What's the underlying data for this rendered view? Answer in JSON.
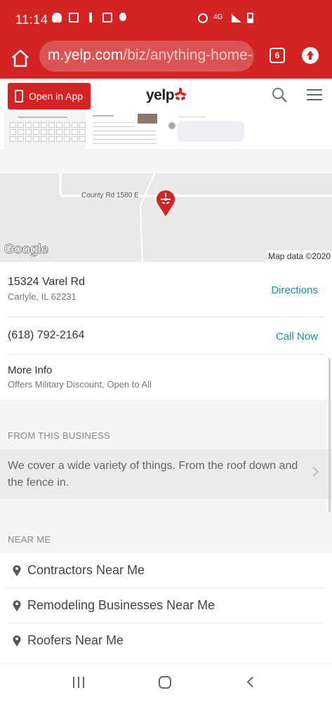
{
  "status_bar": {
    "time": "11:14",
    "network": "4G"
  },
  "browser": {
    "url_host": "m.yelp.com",
    "url_path": "/biz/anything-home-",
    "tab_count": "6"
  },
  "header": {
    "open_app_label": "Open in App",
    "logo_text": "yelp",
    "brand_color": "#d32323"
  },
  "map": {
    "road_label": "County Rd 1580 E",
    "google_label": "Google",
    "credit": "Map data ©2020"
  },
  "address": {
    "street": "15324 Varel Rd",
    "city": "Carlyle, IL 62231",
    "action": "Directions"
  },
  "phone": {
    "number": "(618) 792-2164",
    "action": "Call Now"
  },
  "more_info": {
    "title": "More Info",
    "detail": "Offers Military Discount, Open to All"
  },
  "from_business": {
    "title": "FROM THIS BUSINESS",
    "description": "We cover a wide variety of things. From the roof down and the fence in."
  },
  "near_me": {
    "title": "NEAR ME",
    "items": [
      {
        "label": "Contractors Near Me"
      },
      {
        "label": "Remodeling Businesses Near Me"
      },
      {
        "label": "Roofers Near Me"
      }
    ]
  },
  "link_color": "#1a8cb0"
}
